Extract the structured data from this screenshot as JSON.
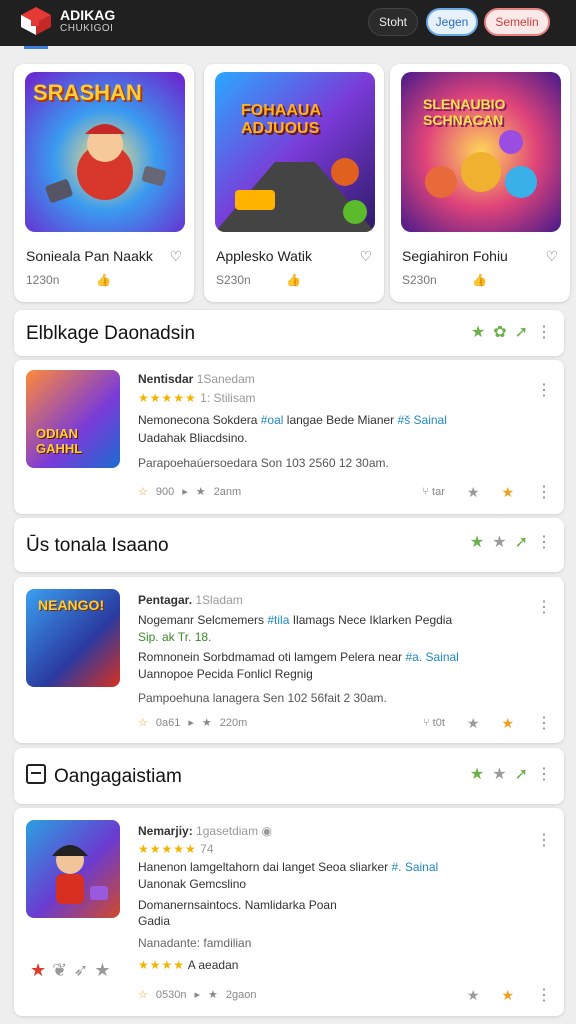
{
  "header": {
    "brand": "ADIKAG",
    "brand_sub": "CHUKIGOI",
    "btn_left": "Stoht",
    "btn_mid": "Jegen",
    "btn_right": "Semelin"
  },
  "cards": [
    {
      "title": "Sonieala Pan Naakk",
      "meta": "1230n",
      "thumb_text": "SRASHAN"
    },
    {
      "title": "Applesko Watik",
      "meta": "S230n",
      "thumb_text": "FOHAAUA ADJUOUS"
    },
    {
      "title": "Segiahiron Fohiu",
      "meta": "S230n",
      "thumb_text": "SLENAUBIO SCHNACAN"
    }
  ],
  "sections": [
    {
      "title": "Elblkage Daonadsin"
    },
    {
      "title": "Ūs tonala Isaano"
    },
    {
      "title": "Oangagaistiam"
    }
  ],
  "items": [
    {
      "name": "Nentisdar",
      "date": "1Sanedam",
      "stars_label": "1:  Stilisam",
      "desc1a": "Nemonecona Sokdera ",
      "desc1b": "#oal",
      "desc1c": " langae Bede Mianer ",
      "desc1d": "#š Sainal",
      "desc2": "Uadahak Bliacdsino.",
      "desc3": "Parapoehaúersoedara Son 103 2560 12 30am.",
      "meta_count": "900",
      "meta_time": "2anm",
      "right1": "tar",
      "art_text": "ODIAN GAHHL"
    },
    {
      "name": "Pentagar.",
      "date": "1Sladam",
      "stars_label": "",
      "desc1a": "Nogemanr Selcmemers ",
      "desc1b": "#tila",
      "desc1c": " Ilamags Nece Iklarken Pegdia",
      "desc2": "Sip. ak  Tr. 18.",
      "desc3a": "Romnonein  Sorbdmamad oti lamgem Pelera near ",
      "desc3b": "#a. Sainal",
      "desc4": "Uannopoe Pecida Fonlicl Regnig",
      "desc5": "Pampoehuna lanagera Sen 102 56fait 2 30am.",
      "meta_count": "0a61",
      "meta_time": "220m",
      "right1": "t0t",
      "art_text": "NEANGO!"
    },
    {
      "name": "Nemarjiy:",
      "date": "1gasetdiam",
      "rating_num": "74",
      "desc1a": "Hanenon lamgeltahorn dai langet  Seoa sliarker ",
      "desc1b": "#. Sainal",
      "desc2": "Uanonak Gemcslino",
      "desc3": "Domanernsaintocs. Namlidarka Poan",
      "desc4": "Gadia",
      "desc5": "Nanadante:  famdilian",
      "stars_label": "A aeadan",
      "meta_count": "0530n",
      "meta_time": "2gaon"
    }
  ],
  "colors": {
    "header_bg": "#202020",
    "accent_blue": "#3d7fe0",
    "star_green": "#6bb04a",
    "star_yellow": "#f3b400",
    "red": "#e03a2a"
  }
}
